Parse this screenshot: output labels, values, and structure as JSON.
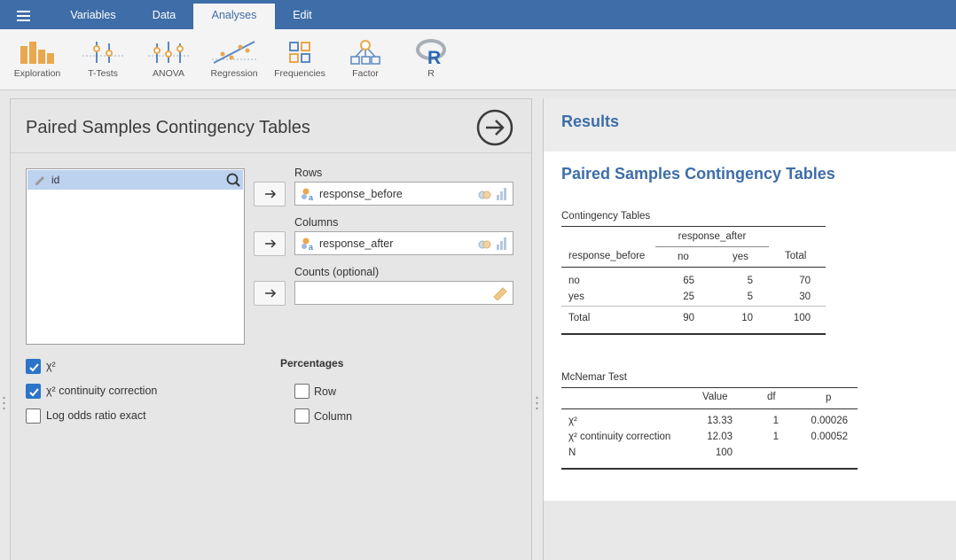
{
  "menubar": {
    "menu_icon": "hamburger-menu-icon",
    "tabs": [
      {
        "label": "Variables"
      },
      {
        "label": "Data"
      },
      {
        "label": "Analyses",
        "active": true
      },
      {
        "label": "Edit"
      }
    ]
  },
  "ribbon": {
    "buttons": [
      {
        "label": "Exploration",
        "icon": "exploration-icon"
      },
      {
        "label": "T-Tests",
        "icon": "t-tests-icon"
      },
      {
        "label": "ANOVA",
        "icon": "anova-icon"
      },
      {
        "label": "Regression",
        "icon": "regression-icon"
      },
      {
        "label": "Frequencies",
        "icon": "frequencies-icon"
      },
      {
        "label": "Factor",
        "icon": "factor-icon"
      },
      {
        "label": "R",
        "icon": "r-icon"
      }
    ]
  },
  "options": {
    "title": "Paired Samples Contingency Tables",
    "variables": [
      "id"
    ],
    "rows": {
      "label": "Rows",
      "value": "response_before"
    },
    "columns": {
      "label": "Columns",
      "value": "response_after"
    },
    "counts": {
      "label": "Counts (optional)",
      "value": ""
    },
    "stats": [
      {
        "label": "χ²",
        "checked": true
      },
      {
        "label": "χ² continuity correction",
        "checked": true
      },
      {
        "label": "Log odds ratio exact",
        "checked": false
      }
    ],
    "percentages": {
      "heading": "Percentages",
      "items": [
        {
          "label": "Row",
          "checked": false
        },
        {
          "label": "Column",
          "checked": false
        }
      ]
    }
  },
  "results": {
    "header": "Results",
    "analysis_title": "Paired Samples Contingency Tables",
    "contingency": {
      "title": "Contingency Tables",
      "col_var": "response_after",
      "row_var": "response_before",
      "col_levels": [
        "no",
        "yes"
      ],
      "total_label": "Total",
      "rows": [
        {
          "label": "no",
          "values": [
            "65",
            "5"
          ],
          "total": "70"
        },
        {
          "label": "yes",
          "values": [
            "25",
            "5"
          ],
          "total": "30"
        },
        {
          "label": "Total",
          "values": [
            "90",
            "10"
          ],
          "total": "100"
        }
      ]
    },
    "mcnemar": {
      "title": "McNemar Test",
      "headers": [
        "Value",
        "df",
        "p"
      ],
      "rows": [
        {
          "label": "χ²",
          "value": "13.33",
          "df": "1",
          "p": "0.00026"
        },
        {
          "label": "χ² continuity correction",
          "value": "12.03",
          "df": "1",
          "p": "0.00052"
        },
        {
          "label": "N",
          "value": "100",
          "df": "",
          "p": ""
        }
      ]
    }
  },
  "colors": {
    "accent": "#3e6da8",
    "checkbox": "#2c74c7",
    "selected_row": "#bcd2ee"
  }
}
